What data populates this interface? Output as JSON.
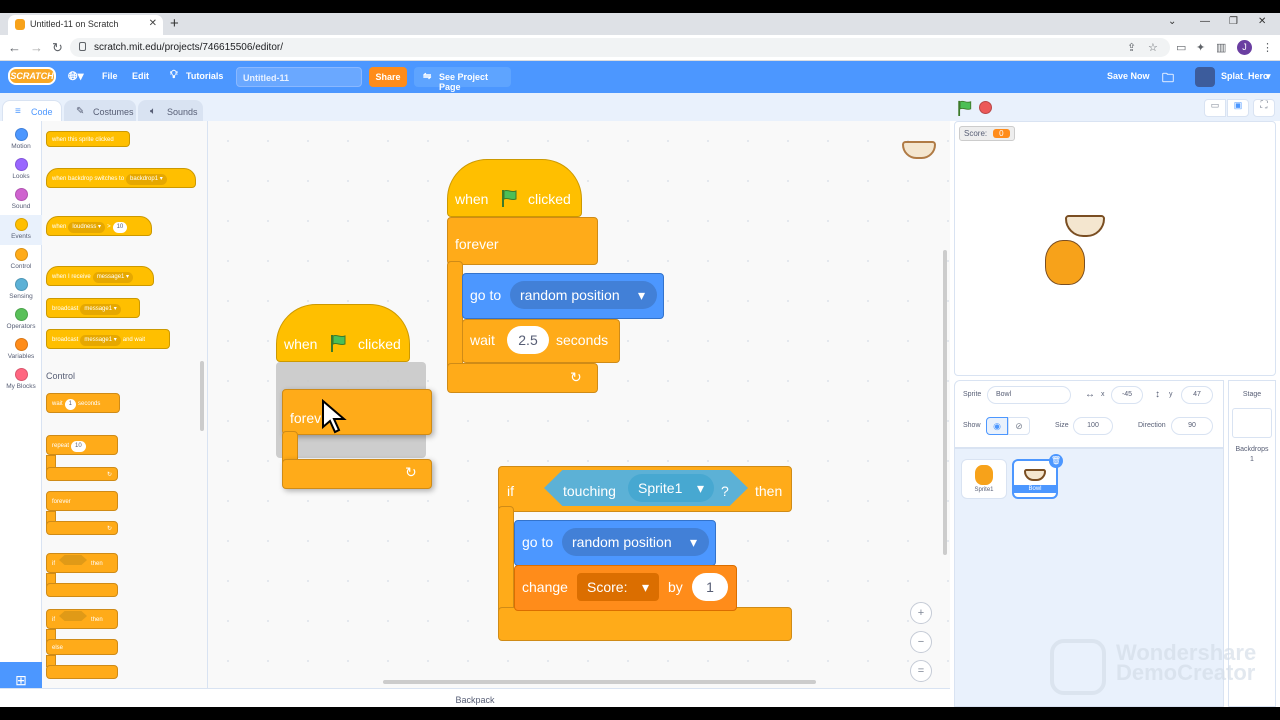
{
  "browser": {
    "tab_title": "Untitled-11 on Scratch",
    "url": "scratch.mit.edu/projects/746615506/editor/",
    "profile_initial": "J"
  },
  "menubar": {
    "logo": "SCRATCH",
    "file": "File",
    "edit": "Edit",
    "tutorials": "Tutorials",
    "project_title": "Untitled-11",
    "share": "Share",
    "see_project": "See Project Page",
    "save_now": "Save Now",
    "username": "Splat_Hero"
  },
  "tabs": {
    "code": "Code",
    "costumes": "Costumes",
    "sounds": "Sounds"
  },
  "categories": [
    {
      "label": "Motion",
      "color": "#4c97ff"
    },
    {
      "label": "Looks",
      "color": "#9966ff"
    },
    {
      "label": "Sound",
      "color": "#cf63cf"
    },
    {
      "label": "Events",
      "color": "#ffbf00"
    },
    {
      "label": "Control",
      "color": "#ffab19"
    },
    {
      "label": "Sensing",
      "color": "#5cb1d6"
    },
    {
      "label": "Operators",
      "color": "#59c059"
    },
    {
      "label": "Variables",
      "color": "#ff8c1a"
    },
    {
      "label": "My Blocks",
      "color": "#ff6680"
    }
  ],
  "palette": {
    "sprite_clicked": "when this sprite clicked",
    "backdrop_switch": "when backdrop switches to",
    "backdrop_val": "backdrop1",
    "when": "when",
    "loudness": "loudness",
    "gt": ">",
    "loud_val": "10",
    "receive": "when I receive",
    "message": "message1",
    "broadcast": "broadcast",
    "broadcast_wait": "and wait",
    "control_heading": "Control",
    "wait": "wait",
    "wait_val": "1",
    "seconds": "seconds",
    "repeat": "repeat",
    "repeat_val": "10",
    "forever": "forever",
    "if": "if",
    "then": "then",
    "else": "else"
  },
  "scripts": {
    "when": "when",
    "clicked": "clicked",
    "forever": "forever",
    "forev_drag": "forev",
    "go_to": "go to",
    "random_position": "random position",
    "wait": "wait",
    "wait_val": "2.5",
    "seconds": "seconds",
    "if": "if",
    "touching": "touching",
    "sprite1": "Sprite1",
    "q": "?",
    "then": "then",
    "change": "change",
    "score": "Score:",
    "by": "by",
    "change_val": "1"
  },
  "workspace": {
    "zoom_in": "+",
    "zoom_out": "−",
    "reset": "=",
    "backpack": "Backpack"
  },
  "stage": {
    "monitor_label": "Score:",
    "monitor_value": "0"
  },
  "sprite_info": {
    "sprite_label": "Sprite",
    "sprite_name": "Bowl",
    "x_label": "x",
    "x": "-45",
    "y_label": "y",
    "y": "47",
    "show": "Show",
    "size_label": "Size",
    "size": "100",
    "direction_label": "Direction",
    "direction": "90"
  },
  "sprites": [
    {
      "name": "Sprite1"
    },
    {
      "name": "Bowl"
    }
  ],
  "stage_pane": {
    "label": "Stage",
    "backdrops_label": "Backdrops",
    "backdrops_count": "1"
  },
  "watermark": {
    "line1": "Wondershare",
    "line2": "DemoCreator"
  }
}
